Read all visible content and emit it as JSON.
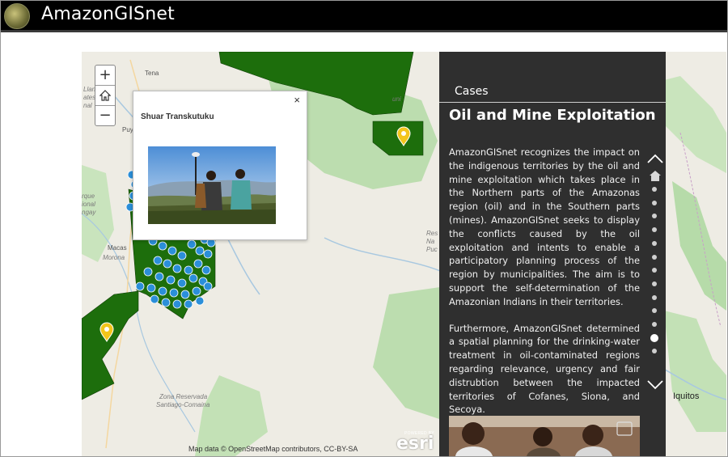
{
  "header": {
    "app_title": "AmazonGISnet",
    "logo_icon": "logo-globe-icon"
  },
  "map": {
    "zoom_in_label": "+",
    "zoom_out_label": "−",
    "home_icon": "home-icon",
    "labels": {
      "tena": "Tena",
      "puyo": "Puyo",
      "macas": "Macas",
      "morona": "Morona",
      "parque_1": "rque",
      "parque_2": "ional",
      "parque_3": "ngay",
      "llan_1": "Llan",
      "llan_2": "ates",
      "llan_3": "nal",
      "reserve_1": "Res",
      "reserve_2": "Na",
      "reserve_3": "Puc",
      "uni": "uni",
      "zona_1": "Zona Reservada",
      "zona_2": "Santiago-Comaina",
      "iquitos": "Iquitos"
    },
    "attribution": "Map data © OpenStreetMap contributors, CC-BY-SA",
    "esri_powered": "POWERED BY",
    "esri_word": "esri",
    "colors": {
      "territory": "#1d6e0c",
      "forest": "#a9d49d",
      "marker": "#f3c51b",
      "cluster": "#2b8fd9"
    }
  },
  "popup": {
    "title": "Shuar Transkutuku",
    "close_label": "×"
  },
  "panel": {
    "tab_label": "Cases",
    "heading": "Oil and Mine Exploitation",
    "paragraph_1": "AmazonGISnet recognizes the impact on the indigenous territories by the oil and mine exploitation which takes place in the Northern parts of the Amazonas region (oil) and in the Southern parts (mines). AmazonGISnet seeks to display the conflicts caused by the oil exploitation and intents to enable a participatory planning process of the region by municipalities. The aim is to support the self-determination of the Amazonian Indians in their territories.",
    "paragraph_2": "Furthermore, AmazonGISnet determined a spatial planning for the drinking-water treatment in oil-contaminated regions regarding relevance, urgency and fair distrubtion between the impacted territories of Cofanes, Siona, and Secoya.",
    "nav_up_icon": "chevron-up-icon",
    "nav_down_icon": "chevron-down-icon",
    "nav_home_icon": "home-icon",
    "nav_dot_count": 13,
    "nav_active_index": 11
  }
}
